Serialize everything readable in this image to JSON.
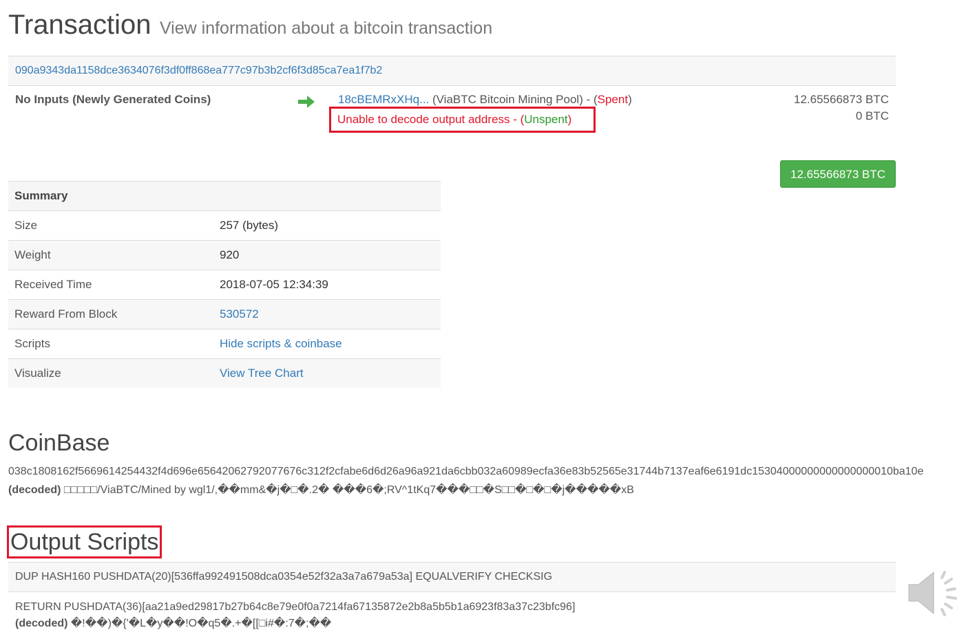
{
  "header": {
    "title": "Transaction",
    "subtitle": "View information about a bitcoin transaction"
  },
  "transaction": {
    "hash": "090a9343da1158dce3634076f3df0ff868ea777c97b3b2cf6f3d85ca7ea1f7b2",
    "inputs_label": "No Inputs (Newly Generated Coins)",
    "outputs": [
      {
        "address": "18cBEMRxXHq...",
        "pool": " (ViaBTC Bitcoin Mining Pool) - (",
        "status": "Spent",
        "close": ")",
        "amount": "12.65566873 BTC"
      },
      {
        "address_text": "Unable to decode output address",
        "sep": " - (",
        "status": "Unspent",
        "close": ")",
        "amount": "0 BTC"
      }
    ],
    "total": "12.65566873 BTC"
  },
  "summary": {
    "heading": "Summary",
    "rows": [
      {
        "key": "Size",
        "value": "257 (bytes)"
      },
      {
        "key": "Weight",
        "value": "920"
      },
      {
        "key": "Received Time",
        "value": "2018-07-05 12:34:39"
      },
      {
        "key": "Reward From Block",
        "value": "530572"
      },
      {
        "key": "Scripts",
        "value": "Hide scripts & coinbase"
      },
      {
        "key": "Visualize",
        "value": "View Tree Chart"
      }
    ]
  },
  "coinbase": {
    "title": "CoinBase",
    "hex": "038c1808162f5669614254432f4d696e65642062792077676c312f2cfabe6d6d26a96a921da6cbb032a60989ecfa36e83b52565e31744b7137eaf6e6191dc15304000000000000000010ba10e",
    "decoded_label": "(decoded)",
    "decoded": " □□□□□/ViaBTC/Mined by wgl1/,��mm&�j�□�.2� ���6�;RV^1tKq7���□□�S□□�□�□�j�����xB"
  },
  "output_scripts": {
    "title": "Output Scripts",
    "script1": "DUP HASH160 PUSHDATA(20)[536ffa992491508dca0354e52f32a3a7a679a53a] EQUALVERIFY CHECKSIG",
    "script2": "RETURN PUSHDATA(36)[aa21a9ed29817b27b64c8e79e0f0a7214fa67135872e2b8a5b5b1a6923f83a37c23bfc96]",
    "decoded_label": "(decoded)",
    "decoded": " �!��)�{'�L�y��!O�q5�.+�[[□i#�:7�;��"
  },
  "colors": {
    "link": "#337ab7",
    "spent": "#e0162b",
    "unspent": "#2b9a2b",
    "button": "#4cae4c",
    "highlight_border": "#e0162b"
  },
  "icons": [
    "arrow-right-icon",
    "speaker-icon"
  ]
}
